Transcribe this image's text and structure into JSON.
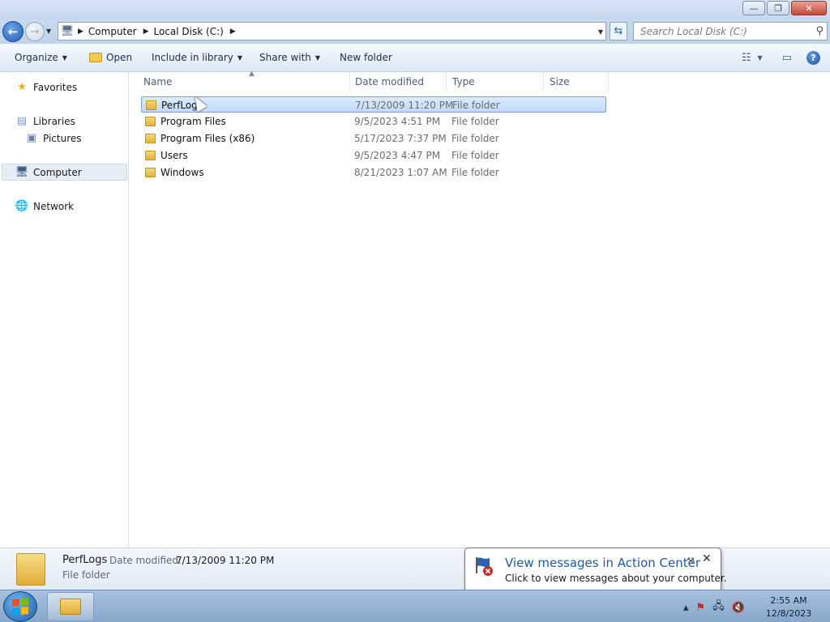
{
  "title_bar": {
    "minimize_glyph": "—",
    "restore_glyph": "❐",
    "close_glyph": "✕"
  },
  "navigation": {
    "back_glyph": "←",
    "forward_glyph": "→",
    "breadcrumbs": [
      "Computer",
      "Local Disk (C:)"
    ],
    "search_placeholder": "Search Local Disk (C:)"
  },
  "command_bar": {
    "organize": "Organize",
    "open": "Open",
    "include_in_library": "Include in library",
    "share_with": "Share with",
    "new_folder": "New folder",
    "help_glyph": "?"
  },
  "nav_pane": {
    "favorites": "Favorites",
    "libraries": "Libraries",
    "pictures": "Pictures",
    "computer": "Computer",
    "network": "Network"
  },
  "columns": [
    "Name",
    "Date modified",
    "Type",
    "Size"
  ],
  "files": [
    {
      "name": "PerfLogs",
      "date": "7/13/2009 11:20 PM",
      "type": "File folder",
      "selected": true
    },
    {
      "name": "Program Files",
      "date": "9/5/2023 4:51 PM",
      "type": "File folder"
    },
    {
      "name": "Program Files (x86)",
      "date": "5/17/2023 7:37 PM",
      "type": "File folder"
    },
    {
      "name": "Users",
      "date": "9/5/2023 4:47 PM",
      "type": "File folder"
    },
    {
      "name": "Windows",
      "date": "8/21/2023 1:07 AM",
      "type": "File folder"
    }
  ],
  "details": {
    "name": "PerfLogs",
    "date_label": "Date modified:",
    "date_value": "7/13/2009 11:20 PM",
    "type": "File folder"
  },
  "balloon": {
    "title": "View messages in Action Center",
    "body": "Click to view messages about your computer."
  },
  "taskbar": {
    "time": "2:55 AM",
    "date": "12/8/2023"
  },
  "colors": {
    "accent": "#1e5aa8",
    "selection": "#c1dbfc",
    "taskbar": "#86a7cb"
  }
}
